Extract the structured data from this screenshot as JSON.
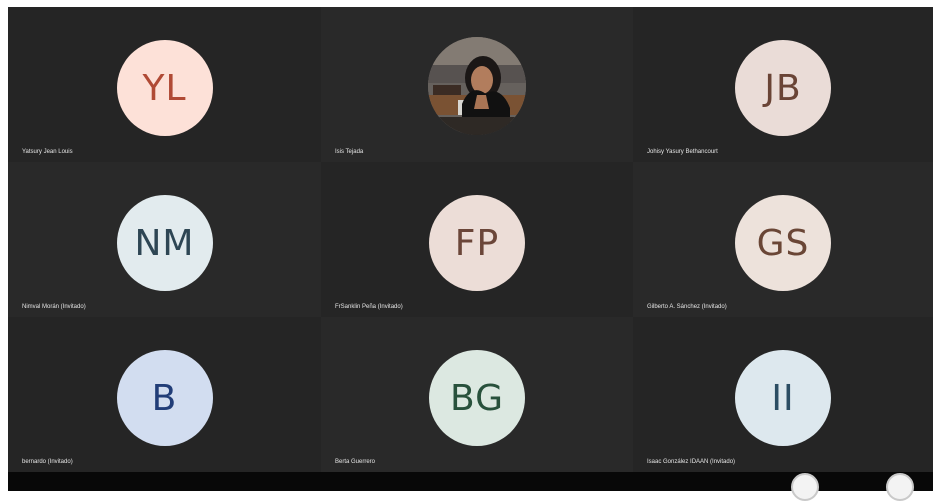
{
  "meeting": {
    "participants": [
      {
        "name": "Yatsury Jean Louis",
        "initials": "YL",
        "avatar_bg": "#fde1d8",
        "avatar_fg": "#b04a35",
        "tile_bg": "#252525"
      },
      {
        "name": "Isis Tejada",
        "initials": "",
        "avatar_bg": "#6f6a66",
        "avatar_fg": "#ffffff",
        "tile_bg": "#292929",
        "photo": true
      },
      {
        "name": "Johisy Yasury Bethancourt",
        "initials": "JB",
        "avatar_bg": "#eadcd7",
        "avatar_fg": "#6a4436",
        "tile_bg": "#252525"
      },
      {
        "name": "Nimval Morán (Invitado)",
        "initials": "NM",
        "avatar_bg": "#e2ebee",
        "avatar_fg": "#2e4654",
        "tile_bg": "#292929"
      },
      {
        "name": "FrSanklin Peña (Invitado)",
        "initials": "FP",
        "avatar_bg": "#ecddd7",
        "avatar_fg": "#6b4639",
        "tile_bg": "#252525"
      },
      {
        "name": "Gilberto A. Sánchez (Invitado)",
        "initials": "GS",
        "avatar_bg": "#ede2db",
        "avatar_fg": "#6a4636",
        "tile_bg": "#292929"
      },
      {
        "name": "bernardo (Invitado)",
        "initials": "B",
        "avatar_bg": "#d2ddf0",
        "avatar_fg": "#213d78",
        "tile_bg": "#252525"
      },
      {
        "name": "Berta Guerrero",
        "initials": "BG",
        "avatar_bg": "#dce8e1",
        "avatar_fg": "#28513c",
        "tile_bg": "#292929"
      },
      {
        "name": "Isaac González IDAAN (Invitado)",
        "initials": "II",
        "avatar_bg": "#dde8ee",
        "avatar_fg": "#2b4d63",
        "tile_bg": "#252525"
      }
    ],
    "controls": [
      {
        "name": "control-button"
      },
      {
        "name": "control-button"
      }
    ]
  }
}
